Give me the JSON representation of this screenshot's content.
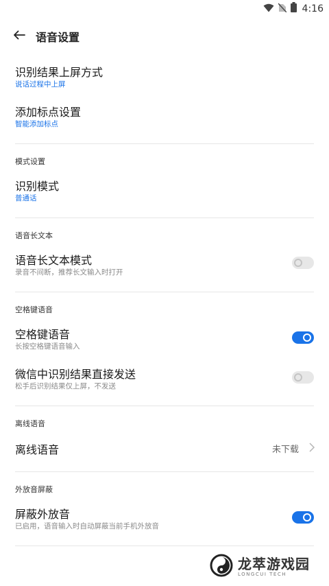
{
  "status": {
    "time": "4:16"
  },
  "header": {
    "title": "语音设置"
  },
  "items": {
    "upscreen": {
      "title": "识别结果上屏方式",
      "value": "说话过程中上屏"
    },
    "punctuation": {
      "title": "添加标点设置",
      "value": "智能添加标点"
    }
  },
  "sections": {
    "mode": {
      "header": "模式设置",
      "title": "识别模式",
      "value": "普通话"
    },
    "longtext": {
      "header": "语音长文本",
      "title": "语音长文本模式",
      "desc": "录音不间断，推荐长文输入时打开",
      "enabled": false
    },
    "space": {
      "header": "空格键语音",
      "space_voice": {
        "title": "空格键语音",
        "desc": "长按空格键语音输入",
        "enabled": true
      },
      "wechat_send": {
        "title": "微信中识别结果直接发送",
        "desc": "松手后识别结果仅上屏，不发送",
        "enabled": false
      }
    },
    "offline": {
      "header": "离线语音",
      "title": "离线语音",
      "value": "未下载"
    },
    "shield": {
      "header": "外放音屏蔽",
      "title": "屏蔽外放音",
      "desc": "已启用，语音输入时自动屏蔽当前手机外放音",
      "enabled": true
    }
  },
  "watermark": {
    "name": "龙萃游戏园",
    "sub": "LONGCUI TECH"
  },
  "colors": {
    "accent": "#1a73e8",
    "divider": "#e6e6e6"
  }
}
